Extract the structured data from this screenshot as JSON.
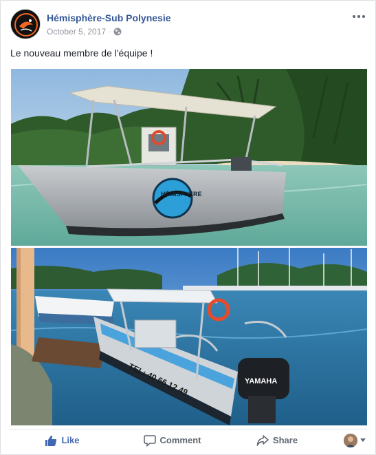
{
  "post": {
    "page_name": "Hémisphère-Sub Polynesie",
    "date": "October 5, 2017",
    "separator": "·",
    "text": "Le nouveau membre de l'équipe !",
    "avatar_icon": "hemisphere-sub-logo",
    "privacy_icon": "globe-icon"
  },
  "photos": [
    {
      "name": "boat-lagoon-photo",
      "boat_logo_text": "HÉMISPHÈRE"
    },
    {
      "name": "boat-marina-photo",
      "hull_text": "TEL: 40 66 12 49",
      "engine_text": "YAMAHA"
    }
  ],
  "actions": {
    "like": "Like",
    "comment": "Comment",
    "share": "Share"
  },
  "colors": {
    "link": "#365899",
    "like": "#4267b2",
    "muted": "#606770",
    "accent_orange": "#f26722"
  }
}
